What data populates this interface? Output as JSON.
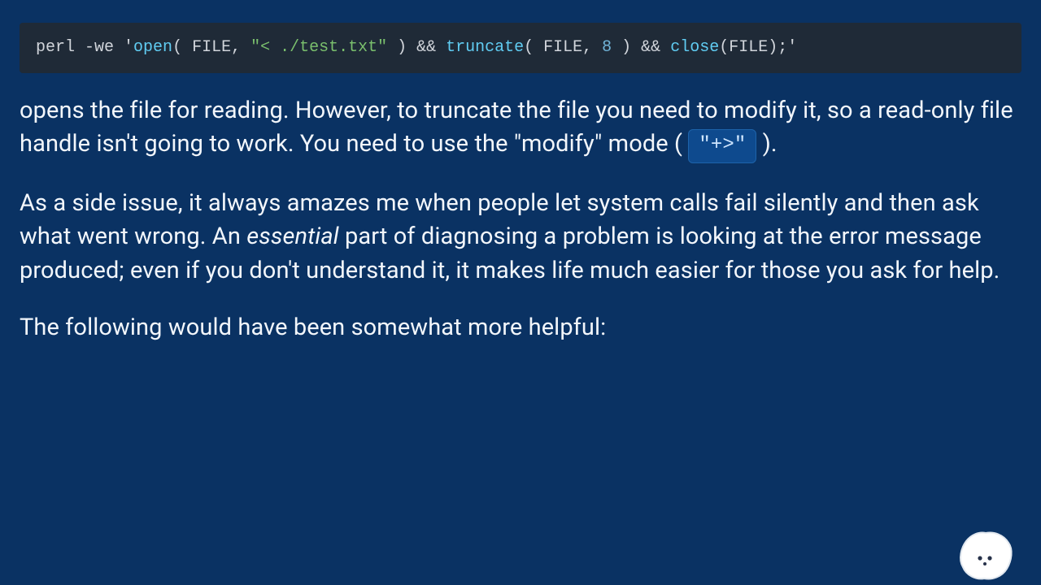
{
  "code": {
    "prefix": "perl -we ",
    "open_quote": "'",
    "open_fn": "open",
    "open_args_a": "( FILE, ",
    "open_string": "\"< ./test.txt\"",
    "open_args_b": " ) && ",
    "trunc_fn": "truncate",
    "trunc_args_a": "( FILE, ",
    "trunc_num": "8",
    "trunc_args_b": " ) && ",
    "close_fn": "close",
    "close_args": "(FILE);",
    "close_quote": "'"
  },
  "para1": {
    "a": "opens the file for reading. However, to truncate the file you need to modify it, so a read-only file handle isn't going to work. You need to use the \"modify\" mode ( ",
    "inline_code": "\"+>\"",
    "b": " )."
  },
  "para2": {
    "a": "As a side issue, it always amazes me when people let system calls fail silently and then ask what went wrong. An ",
    "em": "essential",
    "b": " part of diagnosing a problem is looking at the error message produced; even if you don't understand it, it makes life much easier for those you ask for help."
  },
  "para3": "The following would have been somewhat more helpful:"
}
